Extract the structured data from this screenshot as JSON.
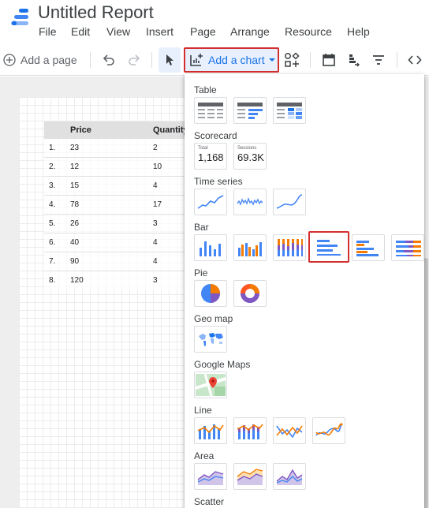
{
  "app": {
    "title": "Untitled Report",
    "menu": [
      "File",
      "Edit",
      "View",
      "Insert",
      "Page",
      "Arrange",
      "Resource",
      "Help"
    ]
  },
  "toolbar": {
    "add_page": "Add a page",
    "add_chart": "Add a chart",
    "icons": [
      "add-page-icon",
      "undo-icon",
      "redo-icon",
      "select-pointer-icon",
      "add-chart-icon",
      "add-control-icon",
      "date-range-icon",
      "data-control-icon",
      "filter-control-icon",
      "code-embed-icon"
    ]
  },
  "table": {
    "headers": [
      "Price",
      "Quantity"
    ],
    "rows": [
      {
        "index": "1.",
        "price": "23",
        "quantity": "2"
      },
      {
        "index": "2.",
        "price": "12",
        "quantity": "10"
      },
      {
        "index": "3.",
        "price": "15",
        "quantity": "4"
      },
      {
        "index": "4.",
        "price": "78",
        "quantity": "17"
      },
      {
        "index": "5.",
        "price": "26",
        "quantity": "3"
      },
      {
        "index": "6.",
        "price": "40",
        "quantity": "4"
      },
      {
        "index": "7.",
        "price": "90",
        "quantity": "4"
      },
      {
        "index": "8.",
        "price": "120",
        "quantity": "3"
      }
    ]
  },
  "chart_menu": {
    "categories": [
      {
        "label": "Table",
        "icons": [
          "table-icon",
          "table-with-bars-icon",
          "table-with-heatmap-icon"
        ]
      },
      {
        "label": "Scorecard",
        "cards": [
          {
            "label": "Total",
            "value": "1,168"
          },
          {
            "label": "Sessions",
            "value": "69.3K"
          }
        ]
      },
      {
        "label": "Time series",
        "icons": [
          "time-series-icon",
          "sparkline-icon",
          "smoothed-time-series-icon"
        ]
      },
      {
        "label": "Bar",
        "icons": [
          "column-chart-icon",
          "stacked-column-icon",
          "100-stacked-column-icon",
          "bar-chart-icon",
          "stacked-bar-icon",
          "100-stacked-bar-icon"
        ],
        "selected": "bar-chart-icon"
      },
      {
        "label": "Pie",
        "icons": [
          "pie-chart-icon",
          "donut-chart-icon"
        ]
      },
      {
        "label": "Geo map",
        "icons": [
          "geo-map-icon"
        ]
      },
      {
        "label": "Google Maps",
        "icons": [
          "google-maps-icon"
        ]
      },
      {
        "label": "Line",
        "icons": [
          "combo-chart-icon",
          "stacked-combo-icon",
          "line-chart-icon",
          "smoothed-line-icon"
        ]
      },
      {
        "label": "Area",
        "icons": [
          "area-chart-icon",
          "stacked-area-icon",
          "100-stacked-area-icon"
        ]
      },
      {
        "label": "Scatter"
      }
    ]
  },
  "colors": {
    "accent": "#1a73e8",
    "highlight": "#d32f2f",
    "orange": "#f57c00",
    "purple": "#7e57c2"
  }
}
